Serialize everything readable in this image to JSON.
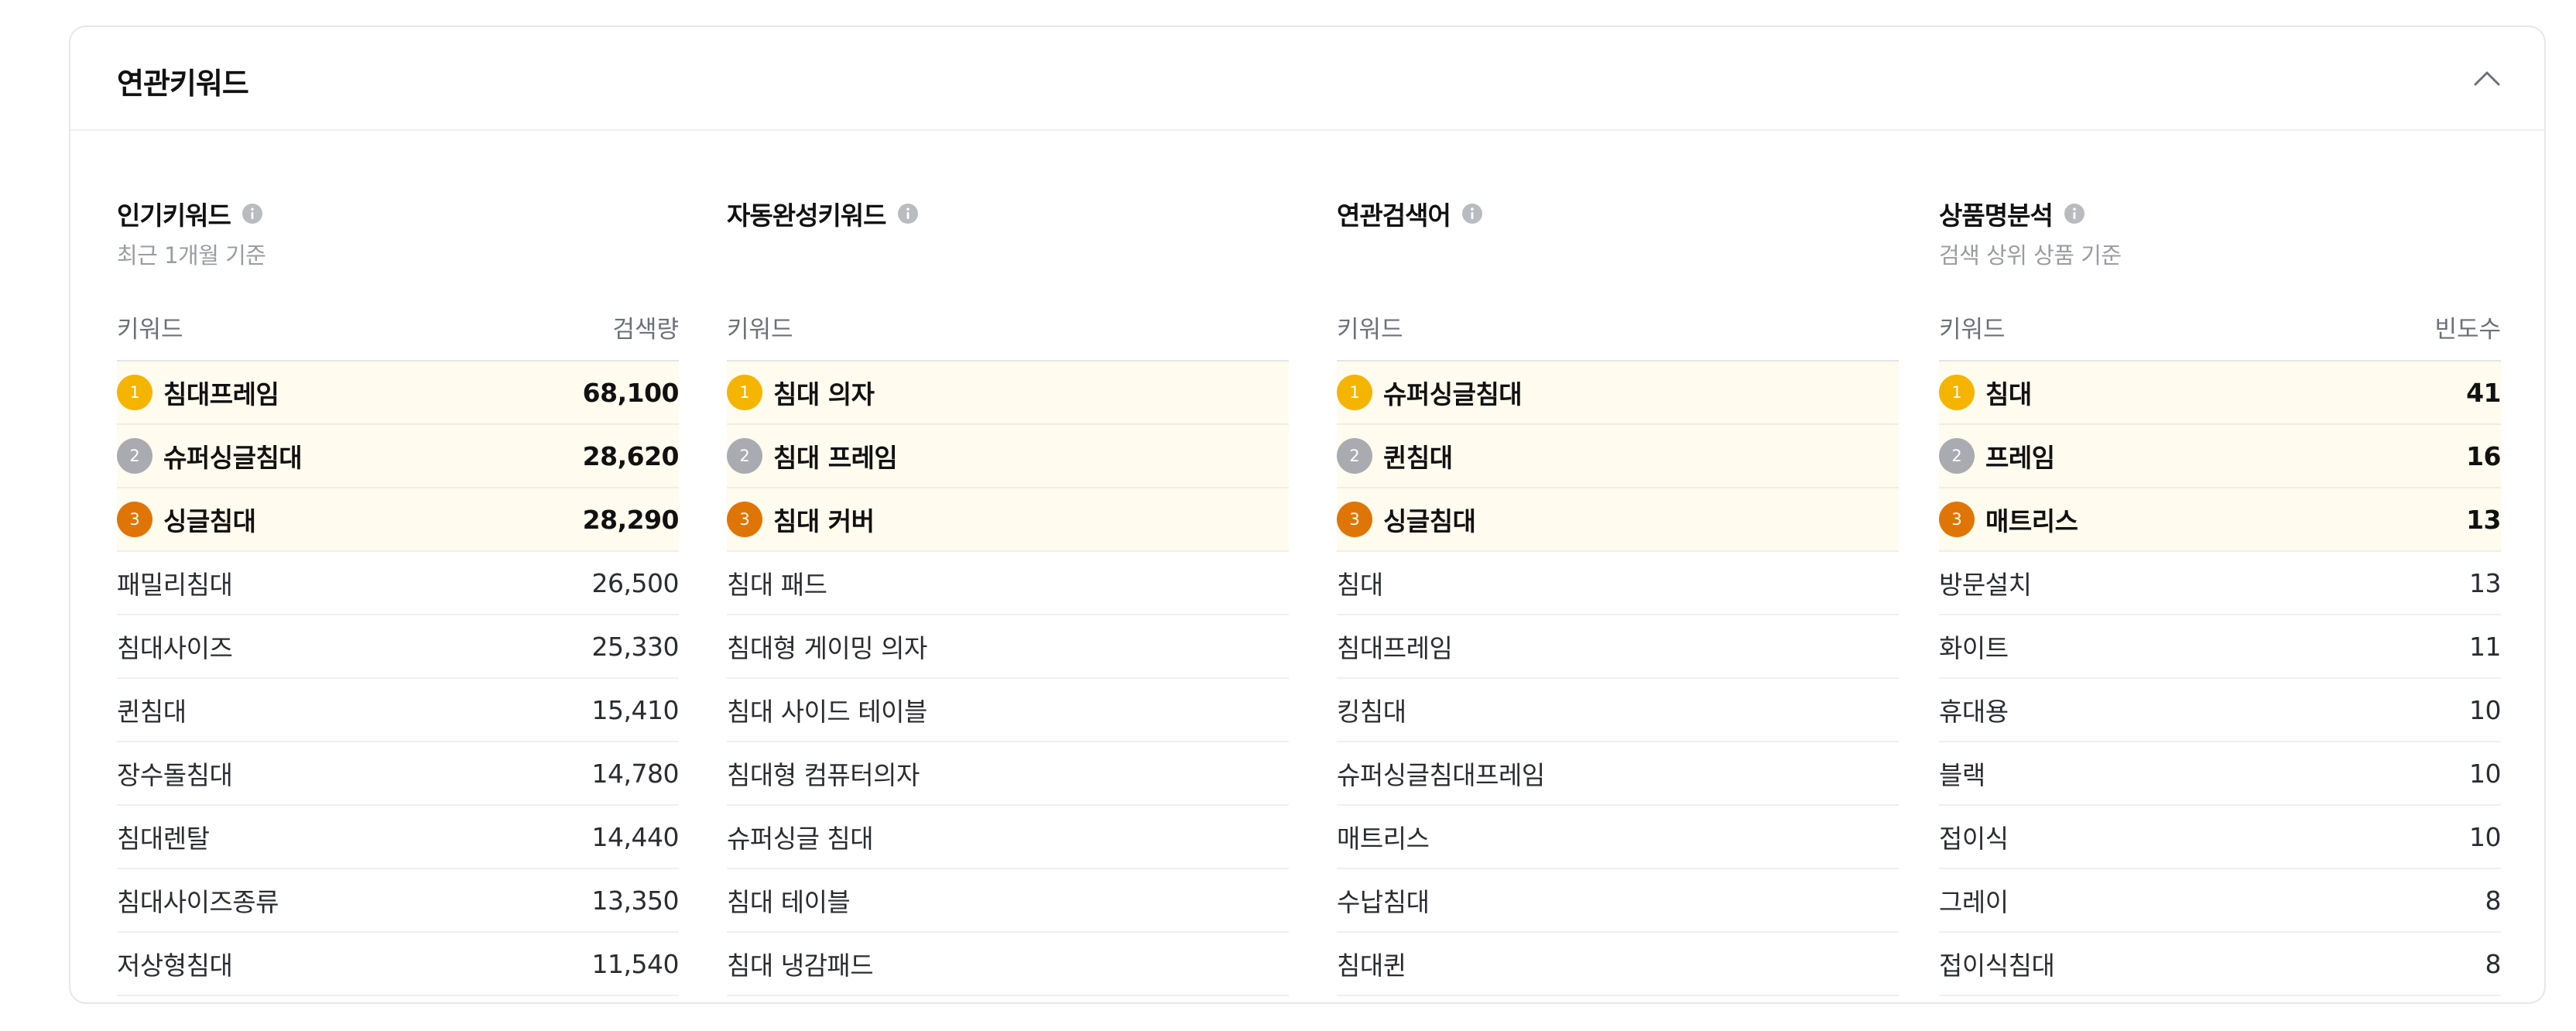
{
  "panel": {
    "title": "연관키워드"
  },
  "colors": {
    "rank1": "#f5b400",
    "rank2": "#a9abb1",
    "rank3": "#e07507",
    "top_row_bg": "#fffbee"
  },
  "icons": {
    "collapse": "chevron-up-icon",
    "info": "info-icon"
  },
  "columns": [
    {
      "title": "인기키워드",
      "subtitle": "최근 1개월 기준",
      "header_left": "키워드",
      "header_right": "검색량",
      "rows": [
        {
          "rank": "1",
          "keyword": "침대프레임",
          "value": "68,100"
        },
        {
          "rank": "2",
          "keyword": "슈퍼싱글침대",
          "value": "28,620"
        },
        {
          "rank": "3",
          "keyword": "싱글침대",
          "value": "28,290"
        },
        {
          "keyword": "패밀리침대",
          "value": "26,500"
        },
        {
          "keyword": "침대사이즈",
          "value": "25,330"
        },
        {
          "keyword": "퀸침대",
          "value": "15,410"
        },
        {
          "keyword": "장수돌침대",
          "value": "14,780"
        },
        {
          "keyword": "침대렌탈",
          "value": "14,440"
        },
        {
          "keyword": "침대사이즈종류",
          "value": "13,350"
        },
        {
          "keyword": "저상형침대",
          "value": "11,540"
        }
      ]
    },
    {
      "title": "자동완성키워드",
      "subtitle": "",
      "header_left": "키워드",
      "header_right": "",
      "rows": [
        {
          "rank": "1",
          "keyword": "침대 의자",
          "value": ""
        },
        {
          "rank": "2",
          "keyword": "침대 프레임",
          "value": ""
        },
        {
          "rank": "3",
          "keyword": "침대 커버",
          "value": ""
        },
        {
          "keyword": "침대 패드",
          "value": ""
        },
        {
          "keyword": "침대형 게이밍 의자",
          "value": ""
        },
        {
          "keyword": "침대 사이드 테이블",
          "value": ""
        },
        {
          "keyword": "침대형 컴퓨터의자",
          "value": ""
        },
        {
          "keyword": "슈퍼싱글 침대",
          "value": ""
        },
        {
          "keyword": "침대 테이블",
          "value": ""
        },
        {
          "keyword": "침대 냉감패드",
          "value": ""
        }
      ]
    },
    {
      "title": "연관검색어",
      "subtitle": "",
      "header_left": "키워드",
      "header_right": "",
      "rows": [
        {
          "rank": "1",
          "keyword": "슈퍼싱글침대",
          "value": ""
        },
        {
          "rank": "2",
          "keyword": "퀸침대",
          "value": ""
        },
        {
          "rank": "3",
          "keyword": "싱글침대",
          "value": ""
        },
        {
          "keyword": "침대",
          "value": ""
        },
        {
          "keyword": "침대프레임",
          "value": ""
        },
        {
          "keyword": "킹침대",
          "value": ""
        },
        {
          "keyword": "슈퍼싱글침대프레임",
          "value": ""
        },
        {
          "keyword": "매트리스",
          "value": ""
        },
        {
          "keyword": "수납침대",
          "value": ""
        },
        {
          "keyword": "침대퀸",
          "value": ""
        }
      ]
    },
    {
      "title": "상품명분석",
      "subtitle": "검색 상위 상품 기준",
      "header_left": "키워드",
      "header_right": "빈도수",
      "rows": [
        {
          "rank": "1",
          "keyword": "침대",
          "value": "41"
        },
        {
          "rank": "2",
          "keyword": "프레임",
          "value": "16"
        },
        {
          "rank": "3",
          "keyword": "매트리스",
          "value": "13"
        },
        {
          "keyword": "방문설치",
          "value": "13"
        },
        {
          "keyword": "화이트",
          "value": "11"
        },
        {
          "keyword": "휴대용",
          "value": "10"
        },
        {
          "keyword": "블랙",
          "value": "10"
        },
        {
          "keyword": "접이식",
          "value": "10"
        },
        {
          "keyword": "그레이",
          "value": "8"
        },
        {
          "keyword": "접이식침대",
          "value": "8"
        }
      ]
    }
  ]
}
